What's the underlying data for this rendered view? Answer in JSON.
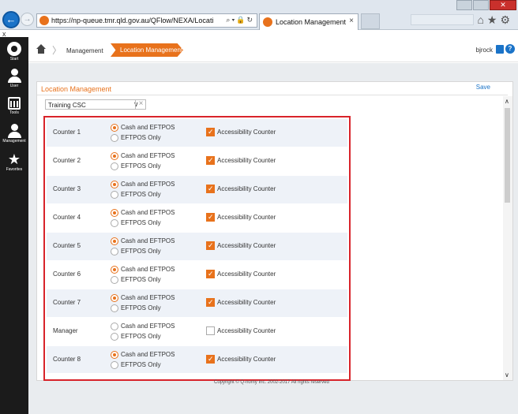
{
  "browser": {
    "url": "https://np-queue.tmr.qld.gov.au/QFlow/NEXA/LocationManac",
    "tab_title": "Location Management",
    "close_tab": "×",
    "close_label": "x"
  },
  "sidebar": {
    "items": [
      {
        "label": "Start",
        "icon": "q-logo-icon"
      },
      {
        "label": "User",
        "icon": "user-icon"
      },
      {
        "label": "Tools",
        "icon": "calendar-icon"
      },
      {
        "label": "Management",
        "icon": "management-icon"
      },
      {
        "label": "Favorites",
        "icon": "star-icon"
      }
    ]
  },
  "header": {
    "breadcrumb": [
      "Management",
      "Location Management"
    ],
    "username": "bjrock",
    "help": "?"
  },
  "panel": {
    "title": "Location Management",
    "save_label": "Save",
    "location_value": "Training CSC",
    "clear_label": "×"
  },
  "labels": {
    "option_cash": "Cash and EFTPOS",
    "option_eftpos": "EFTPOS Only",
    "accessibility": "Accessibility Counter"
  },
  "counters": [
    {
      "name": "Counter 1",
      "payment": "cash",
      "accessibility": true
    },
    {
      "name": "Counter 2",
      "payment": "cash",
      "accessibility": true
    },
    {
      "name": "Counter 3",
      "payment": "cash",
      "accessibility": true
    },
    {
      "name": "Counter 4",
      "payment": "cash",
      "accessibility": true
    },
    {
      "name": "Counter 5",
      "payment": "cash",
      "accessibility": true
    },
    {
      "name": "Counter 6",
      "payment": "cash",
      "accessibility": true
    },
    {
      "name": "Counter 7",
      "payment": "cash",
      "accessibility": true
    },
    {
      "name": "Manager",
      "payment": "none",
      "accessibility": false
    },
    {
      "name": "Counter 8",
      "payment": "cash",
      "accessibility": true
    }
  ],
  "footer": {
    "copyright": "Copyright © Q-nomy Inc. 2002-2017 All rights reserved"
  },
  "colors": {
    "accent": "#e8721c",
    "highlight": "#d8232a",
    "link": "#1a73c8"
  }
}
